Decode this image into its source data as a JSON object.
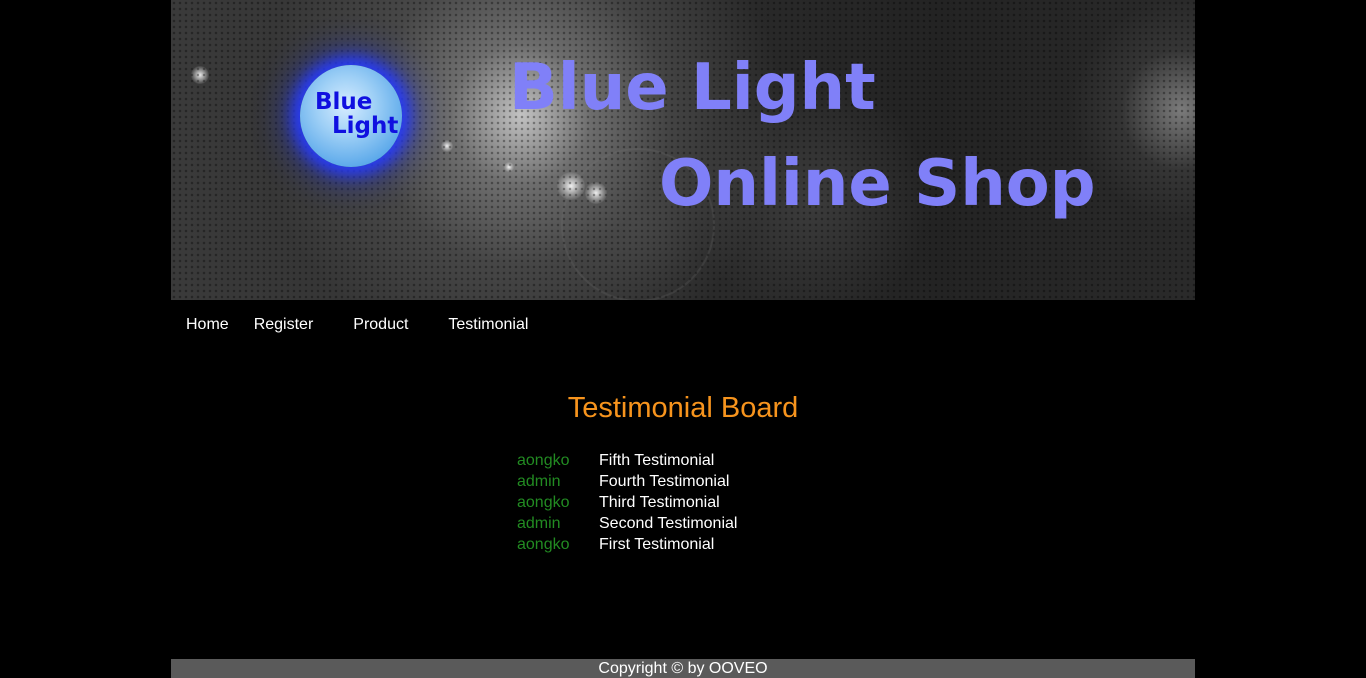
{
  "banner": {
    "logo_line1": "Blue",
    "logo_line2": "Light",
    "title_line1": "Blue Light",
    "title_line2": "Online Shop"
  },
  "nav": {
    "items": [
      {
        "label": "Home"
      },
      {
        "label": "Register"
      },
      {
        "label": "Product"
      },
      {
        "label": "Testimonial"
      }
    ]
  },
  "board": {
    "title": "Testimonial Board",
    "entries": [
      {
        "user": "aongko",
        "message": "Fifth Testimonial"
      },
      {
        "user": "admin",
        "message": "Fourth Testimonial"
      },
      {
        "user": "aongko",
        "message": "Third Testimonial"
      },
      {
        "user": "admin",
        "message": "Second Testimonial"
      },
      {
        "user": "aongko",
        "message": "First Testimonial"
      }
    ]
  },
  "footer": {
    "text": "Copyright © by OOVEO"
  },
  "colors": {
    "title_blue": "#8080f8",
    "logo_text": "#1010e0",
    "board_title": "#f7941d",
    "username": "#228b22",
    "footer_bg": "#5a5a5a"
  }
}
